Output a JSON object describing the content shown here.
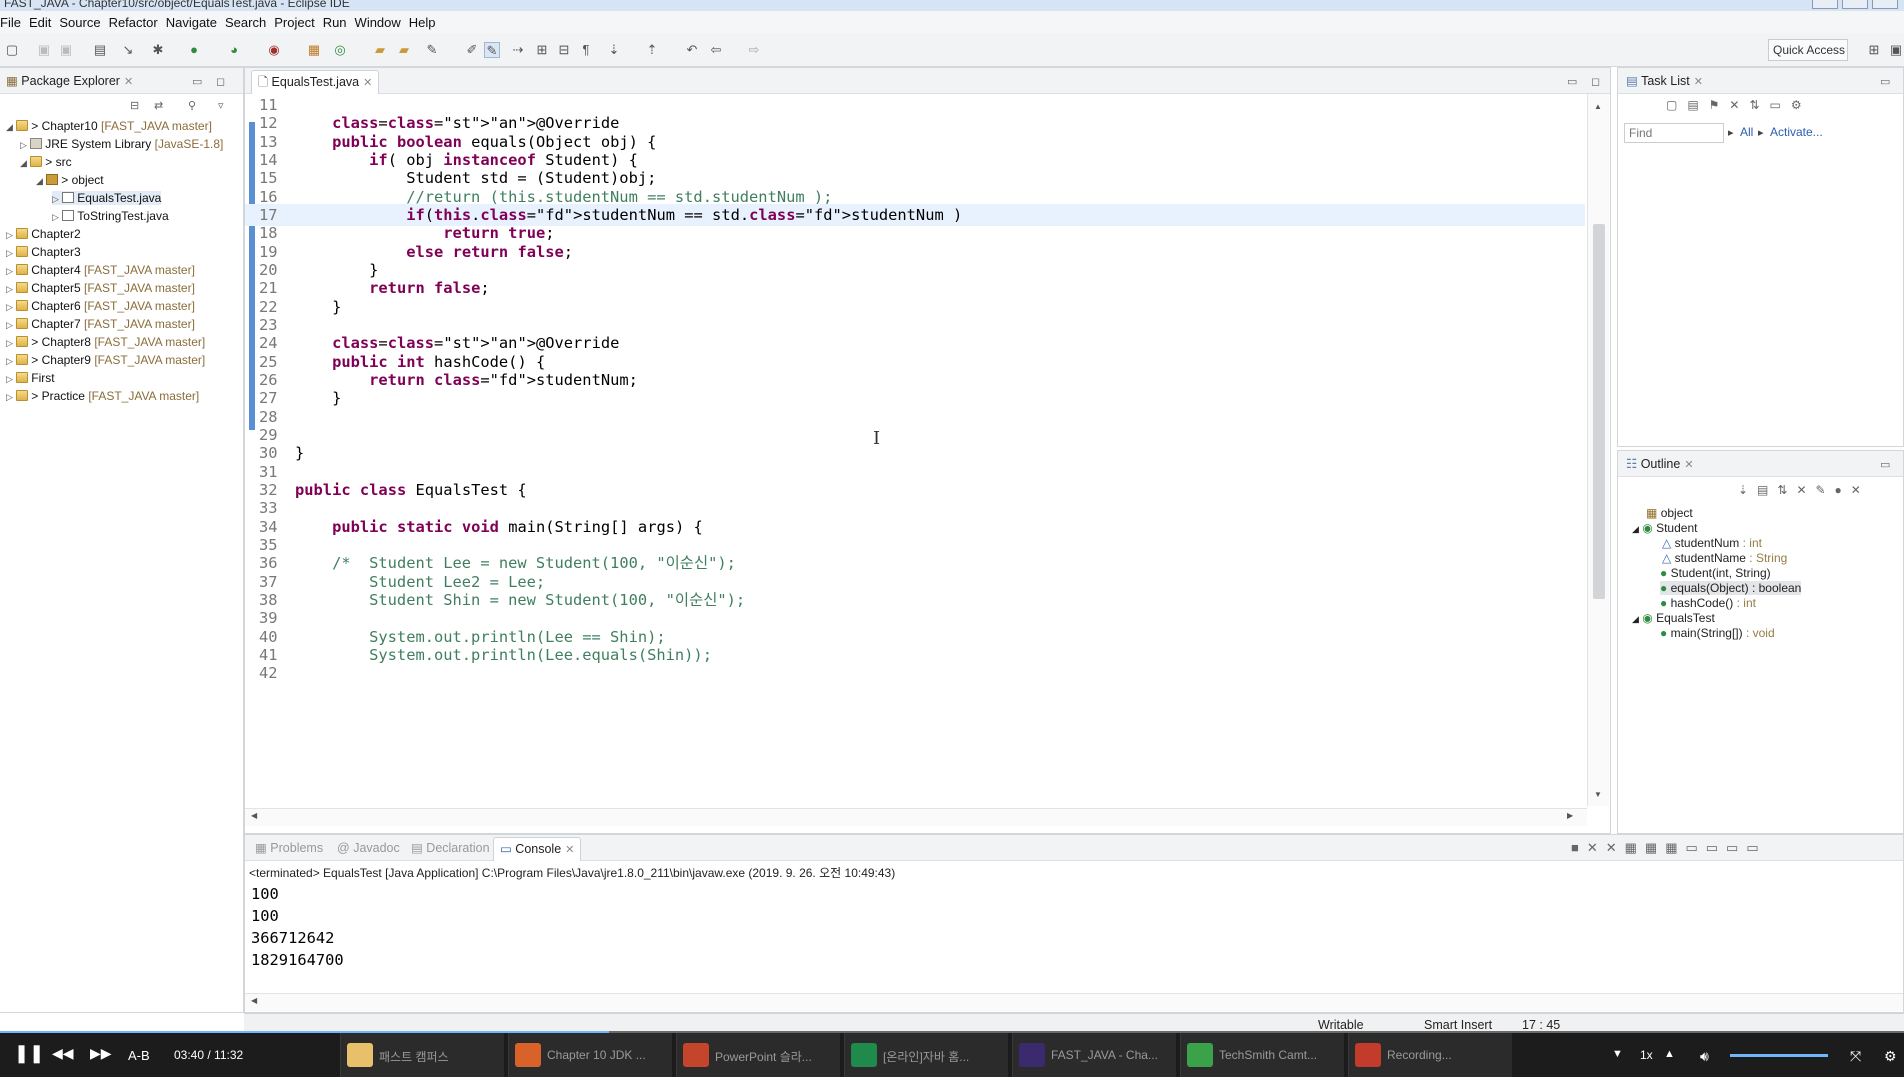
{
  "window": {
    "title": "FAST_JAVA - Chapter10/src/object/EqualsTest.java - Eclipse IDE"
  },
  "menu": [
    "File",
    "Edit",
    "Source",
    "Refactor",
    "Navigate",
    "Search",
    "Project",
    "Run",
    "Window",
    "Help"
  ],
  "toolbar": {
    "quick_access": "Quick Access"
  },
  "package_explorer": {
    "title": "Package Explorer",
    "items": [
      {
        "label": "> Chapter10",
        "suffix": "[FAST_JAVA master]"
      },
      {
        "label": "JRE System Library",
        "suffix": "[JavaSE-1.8]"
      },
      {
        "label": "> src",
        "suffix": ""
      },
      {
        "label": "> object",
        "suffix": ""
      },
      {
        "label": "EqualsTest.java",
        "suffix": ""
      },
      {
        "label": "ToStringTest.java",
        "suffix": ""
      },
      {
        "label": "Chapter2",
        "suffix": ""
      },
      {
        "label": "Chapter3",
        "suffix": ""
      },
      {
        "label": "Chapter4",
        "suffix": "[FAST_JAVA master]"
      },
      {
        "label": "Chapter5",
        "suffix": "[FAST_JAVA master]"
      },
      {
        "label": "Chapter6",
        "suffix": "[FAST_JAVA master]"
      },
      {
        "label": "Chapter7",
        "suffix": "[FAST_JAVA master]"
      },
      {
        "label": "> Chapter8",
        "suffix": "[FAST_JAVA master]"
      },
      {
        "label": "> Chapter9",
        "suffix": "[FAST_JAVA master]"
      },
      {
        "label": "First",
        "suffix": ""
      },
      {
        "label": "> Practice",
        "suffix": "[FAST_JAVA master]"
      }
    ]
  },
  "editor": {
    "tab": "EqualsTest.java",
    "lines": [
      {
        "n": "11",
        "code": ""
      },
      {
        "n": "12",
        "code": "    @Override"
      },
      {
        "n": "13",
        "code": "    public boolean equals(Object obj) {"
      },
      {
        "n": "14",
        "code": "        if( obj instanceof Student) {"
      },
      {
        "n": "15",
        "code": "            Student std = (Student)obj;"
      },
      {
        "n": "16",
        "code": "            //return (this.studentNum == std.studentNum );"
      },
      {
        "n": "17",
        "code": "            if(this.studentNum == std.studentNum )"
      },
      {
        "n": "18",
        "code": "                return true;"
      },
      {
        "n": "19",
        "code": "            else return false;"
      },
      {
        "n": "20",
        "code": "        }"
      },
      {
        "n": "21",
        "code": "        return false;"
      },
      {
        "n": "22",
        "code": "    }"
      },
      {
        "n": "23",
        "code": ""
      },
      {
        "n": "24",
        "code": "    @Override"
      },
      {
        "n": "25",
        "code": "    public int hashCode() {"
      },
      {
        "n": "26",
        "code": "        return studentNum;"
      },
      {
        "n": "27",
        "code": "    }"
      },
      {
        "n": "28",
        "code": ""
      },
      {
        "n": "29",
        "code": ""
      },
      {
        "n": "30",
        "code": "}"
      },
      {
        "n": "31",
        "code": ""
      },
      {
        "n": "32",
        "code": "public class EqualsTest {"
      },
      {
        "n": "33",
        "code": ""
      },
      {
        "n": "34",
        "code": "    public static void main(String[] args) {"
      },
      {
        "n": "35",
        "code": ""
      },
      {
        "n": "36",
        "code": "    /*  Student Lee = new Student(100, \"이순신\");"
      },
      {
        "n": "37",
        "code": "        Student Lee2 = Lee;"
      },
      {
        "n": "38",
        "code": "        Student Shin = new Student(100, \"이순신\");"
      },
      {
        "n": "39",
        "code": ""
      },
      {
        "n": "40",
        "code": "        System.out.println(Lee == Shin);"
      },
      {
        "n": "41",
        "code": "        System.out.println(Lee.equals(Shin));"
      },
      {
        "n": "42",
        "code": ""
      }
    ]
  },
  "task_list": {
    "title": "Task List",
    "find_placeholder": "Find",
    "all": "All",
    "activate": "Activate..."
  },
  "outline": {
    "title": "Outline",
    "items": [
      {
        "name": "object",
        "type": ""
      },
      {
        "name": "Student",
        "type": ""
      },
      {
        "name": "studentNum",
        "type": ": int"
      },
      {
        "name": "studentName",
        "type": ": String"
      },
      {
        "name": "Student(int, String)",
        "type": ""
      },
      {
        "name": "equals(Object) : boolean",
        "type": ""
      },
      {
        "name": "hashCode()",
        "type": ": int"
      },
      {
        "name": "EqualsTest",
        "type": ""
      },
      {
        "name": "main(String[])",
        "type": ": void"
      }
    ]
  },
  "bottom_tabs": [
    "Problems",
    "Javadoc",
    "Declaration",
    "Console"
  ],
  "console": {
    "header": "<terminated> EqualsTest [Java Application] C:\\Program Files\\Java\\jre1.8.0_211\\bin\\javaw.exe (2019. 9. 26. 오전 10:49:43)",
    "output": [
      "100",
      "100",
      "366712642",
      "1829164700"
    ]
  },
  "status": {
    "writable": "Writable",
    "insert": "Smart Insert",
    "position": "17 : 45"
  },
  "player": {
    "ab": "A-B",
    "time": "03:40 / 11:32",
    "speed": "1x",
    "progress": 0.32,
    "tasks": [
      {
        "label": "패스트 캠퍼스",
        "color": "#e8c06a"
      },
      {
        "label": "Chapter 10 JDK ...",
        "color": "#d9622b"
      },
      {
        "label": "PowerPoint 슬라...",
        "color": "#c4452c"
      },
      {
        "label": "[온라인]자바 홈...",
        "color": "#1f8a4c"
      },
      {
        "label": "FAST_JAVA - Cha...",
        "color": "#3c2a6e"
      },
      {
        "label": "TechSmith Camt...",
        "color": "#3aa34a"
      },
      {
        "label": "Recording...",
        "color": "#c23b2b"
      }
    ]
  }
}
